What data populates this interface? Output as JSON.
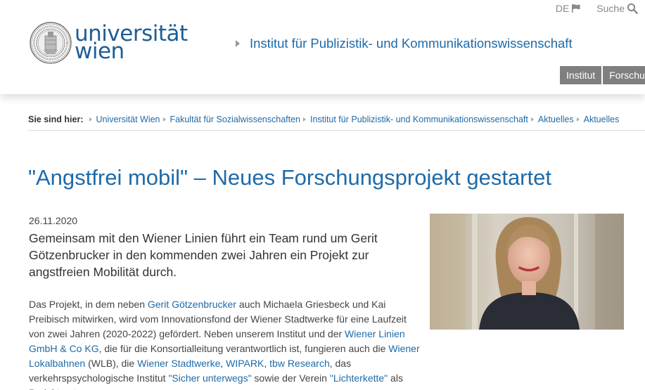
{
  "utility": {
    "lang": "DE",
    "search": "Suche"
  },
  "logo": {
    "line1": "universität",
    "line2": "wien"
  },
  "institute_title": "Institut für Publizistik- und Kommunikationswissenschaft",
  "tabs": [
    "Institut",
    "Forschung"
  ],
  "breadcrumb": {
    "label": "Sie sind hier:",
    "items": [
      "Universität Wien",
      "Fakultät für Sozialwissenschaften",
      "Institut für Publizistik- und Kommunikationswissenschaft",
      "Aktuelles",
      "Aktuelles"
    ]
  },
  "article": {
    "title": "\"Angstfrei mobil\" – Neues Forschungsprojekt gestartet",
    "date": "26.11.2020",
    "lead": "Gemeinsam mit den Wiener Linien führt ein Team rund um Gerit Götzenbrucker in den kommenden zwei Jahren ein Projekt zur angstfreien Mobilität durch.",
    "body": {
      "t1": "Das Projekt, in dem neben ",
      "l1": "Gerit Götzenbrucker",
      "t2": " auch Michaela Griesbeck und Kai Preibisch mitwirken, wird vom Innovationsfond der Wiener Stadtwerke für eine Laufzeit von zwei Jahren (2020-2022) gefördert. Neben unserem Institut und der ",
      "l2": "Wiener Linien GmbH & Co KG",
      "t3": ", die für die Konsortialleitung verantwortlich ist, fungieren auch die ",
      "l3": "Wiener Lokalbahnen",
      "t4": " (WLB), die ",
      "l4": "Wiener Stadtwerke",
      "t5": ", ",
      "l5": "WIPARK",
      "t6": ", ",
      "l6": "tbw Research",
      "t7": ", das verkehrspsychologische Institut ",
      "l7": "\"Sicher unterwegs\"",
      "t8": " sowie der Verein ",
      "l8": "\"Lichterkette\"",
      "t9": " als Projektpartner."
    }
  },
  "colors": {
    "brand_blue": "#1e6aa8",
    "tab_gray": "#7f7f7f"
  }
}
